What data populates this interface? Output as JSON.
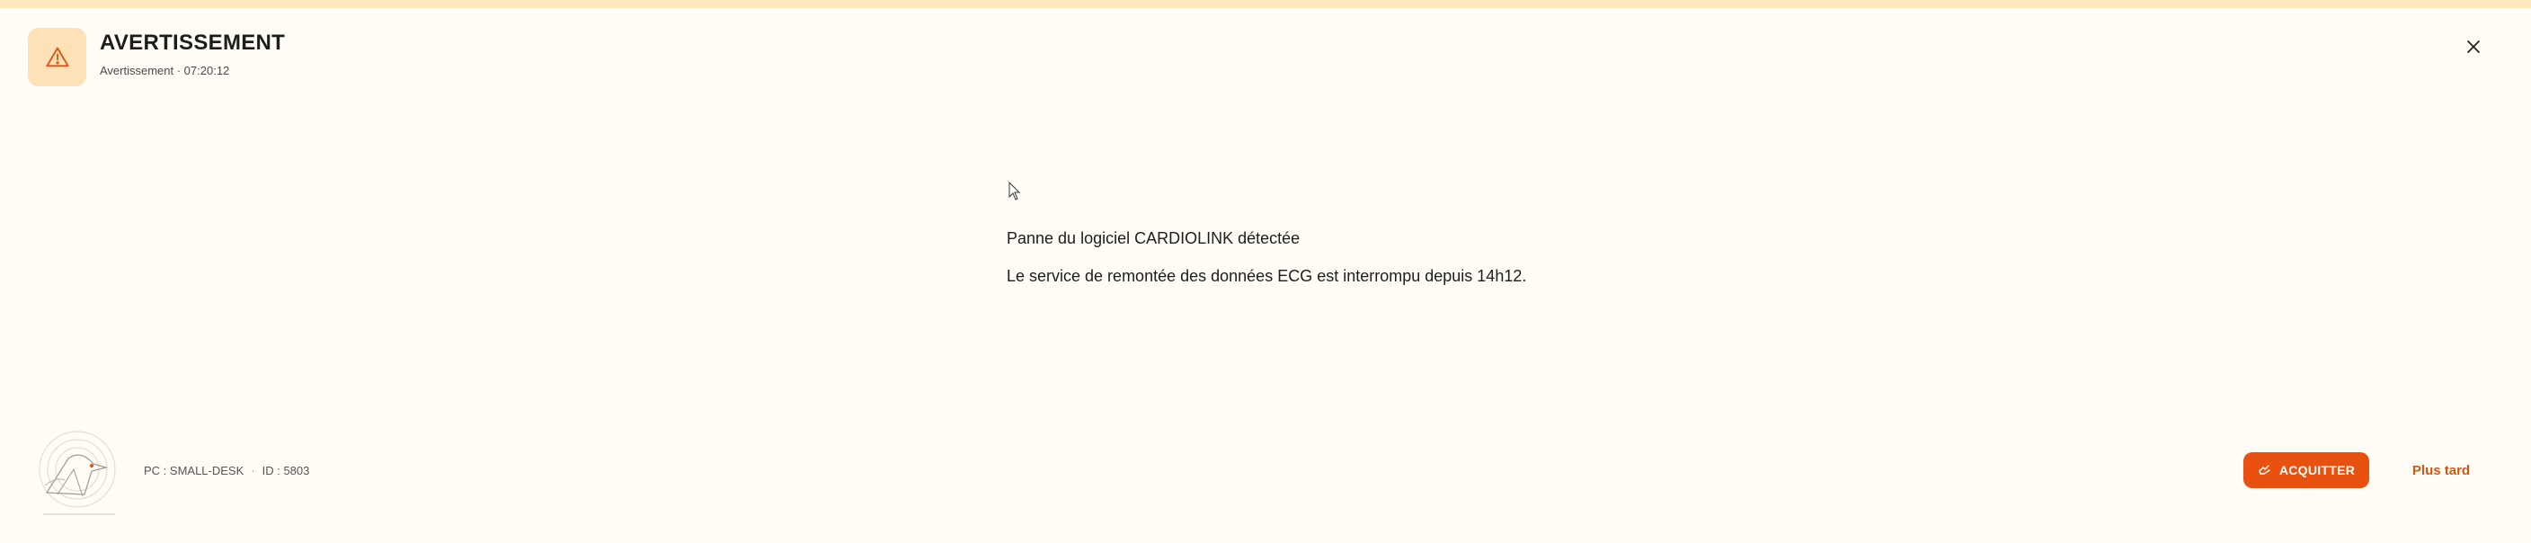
{
  "header": {
    "title": "AVERTISSEMENT",
    "subtitle": "Avertissement · 07:20:12",
    "icon": "warning-triangle-icon",
    "close_icon": "close-icon"
  },
  "message": {
    "title": "Panne du logiciel CARDIOLINK détectée",
    "body": "Le service de remontée des données ECG est interrompu depuis 14h12."
  },
  "footer": {
    "pc": "PC : SMALL-DESK",
    "separator": "·",
    "id": "ID : 5803",
    "logo": "logo-emblem"
  },
  "actions": {
    "acknowledge_label": "ACQUITTER",
    "acknowledge_icon": "hand-icon",
    "later_label": "Plus tard"
  },
  "colors": {
    "accent": "#e8510f",
    "top_strip": "#fde8bd",
    "badge_bg": "#fde2b8",
    "background": "#fffcf5"
  }
}
